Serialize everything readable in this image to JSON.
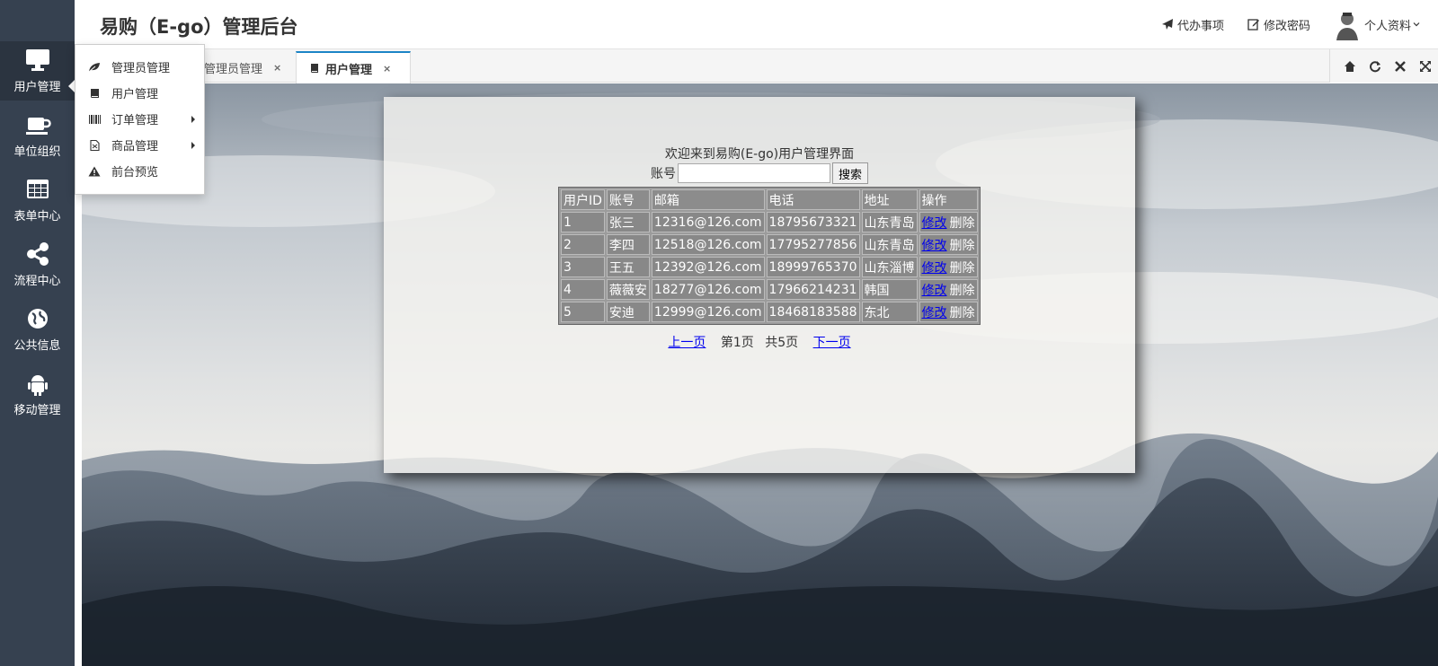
{
  "app": {
    "title": "易购（E-go）管理后台"
  },
  "header": {
    "todo_label": "代办事项",
    "password_label": "修改密码",
    "profile_label": "个人资料"
  },
  "sidebar": {
    "items": [
      {
        "label": "用户管理",
        "icon": "monitor-icon"
      },
      {
        "label": "单位组织",
        "icon": "coffee-cup-icon"
      },
      {
        "label": "表单中心",
        "icon": "table-grid-icon"
      },
      {
        "label": "流程中心",
        "icon": "share-icon"
      },
      {
        "label": "公共信息",
        "icon": "globe-icon"
      },
      {
        "label": "移动管理",
        "icon": "android-icon"
      }
    ]
  },
  "dropdown": {
    "items": [
      {
        "label": "管理员管理",
        "icon": "leaf-icon"
      },
      {
        "label": "用户管理",
        "icon": "book-icon"
      },
      {
        "label": "订单管理",
        "icon": "barcode-icon",
        "has_submenu": true
      },
      {
        "label": "商品管理",
        "icon": "file-icon",
        "has_submenu": true
      },
      {
        "label": "前台预览",
        "icon": "warning-icon"
      }
    ]
  },
  "tabs": [
    {
      "label": "管理员管理",
      "active": false
    },
    {
      "label": "用户管理",
      "active": true
    }
  ],
  "tab_close_glyph": "×",
  "tab_tools": [
    "home-icon",
    "refresh-icon",
    "close-icon",
    "fullscreen-icon"
  ],
  "main": {
    "welcome": "欢迎来到易购(E-go)用户管理界面",
    "search_label": "账号",
    "search_value": "",
    "search_button": "搜索",
    "table": {
      "headers": [
        "用户ID",
        "账号",
        "邮箱",
        "电话",
        "地址",
        "操作"
      ],
      "rows": [
        [
          "1",
          "张三",
          "12316@126.com",
          "18795673321",
          "山东青岛"
        ],
        [
          "2",
          "李四",
          "12518@126.com",
          "17795277856",
          "山东青岛"
        ],
        [
          "3",
          "王五",
          "12392@126.com",
          "18999765370",
          "山东淄博"
        ],
        [
          "4",
          "薇薇安",
          "18277@126.com",
          "17966214231",
          "韩国"
        ],
        [
          "5",
          "安迪",
          "12999@126.com",
          "18468183588",
          "东北"
        ]
      ],
      "edit_label": "修改",
      "delete_label": "删除"
    },
    "pager": {
      "prev": "上一页",
      "current": "第1页",
      "total": "共5页",
      "next": "下一页"
    }
  },
  "colors": {
    "sidebar_bg": "#364150",
    "tab_accent": "#1c84c6",
    "link": "#0000ee"
  }
}
